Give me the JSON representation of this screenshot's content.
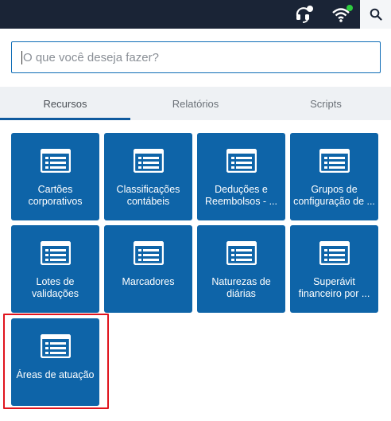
{
  "search": {
    "placeholder": "O que você deseja fazer?"
  },
  "tabs": [
    {
      "label": "Recursos",
      "active": true
    },
    {
      "label": "Relatórios",
      "active": false
    },
    {
      "label": "Scripts",
      "active": false
    }
  ],
  "cards": [
    {
      "label": "Cartões corporativos",
      "icon": "list-icon"
    },
    {
      "label": "Classificações contábeis",
      "icon": "list-icon"
    },
    {
      "label": "Deduções e Reembolsos - ...",
      "icon": "list-icon"
    },
    {
      "label": "Grupos de configuração de ...",
      "icon": "list-icon"
    },
    {
      "label": "Lotes de validações",
      "icon": "list-icon"
    },
    {
      "label": "Marcadores",
      "icon": "list-icon"
    },
    {
      "label": "Naturezas de diárias",
      "icon": "list-icon"
    },
    {
      "label": "Superávit financeiro por ...",
      "icon": "list-icon"
    },
    {
      "label": "Áreas de atuação",
      "icon": "list-icon"
    }
  ],
  "colors": {
    "topbar": "#1a2436",
    "card": "#0e64a8",
    "accent": "#0f5a9e",
    "highlight": "#e0141d",
    "status_dot": "#2ecc40"
  }
}
